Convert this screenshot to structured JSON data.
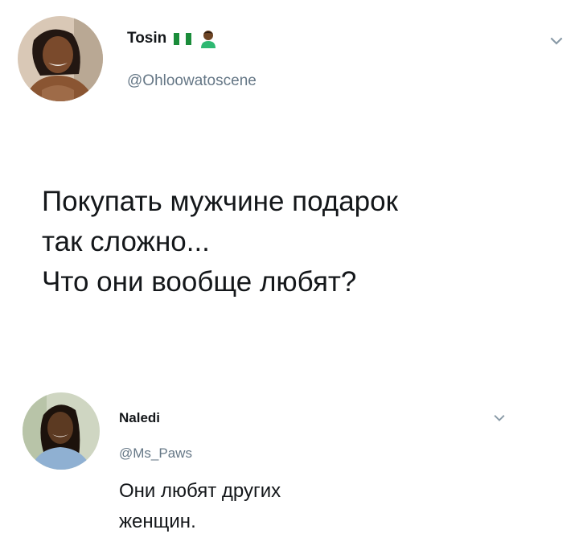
{
  "tweet": {
    "author_name": "Tosin",
    "author_handle": "@Ohloowatoscene",
    "name_badges": [
      "nigeria-flag-icon",
      "person-icon"
    ],
    "text_lines": [
      "Покупать мужчине подарок",
      "так сложно...",
      "Что они вообще любят?"
    ]
  },
  "reply": {
    "author_name": "Naledi",
    "author_handle": "@Ms_Paws",
    "text_lines": [
      "Они любят других",
      "женщин."
    ]
  },
  "colors": {
    "text": "#14171a",
    "secondary": "#657786",
    "flag_green": "#1a8c3a"
  }
}
